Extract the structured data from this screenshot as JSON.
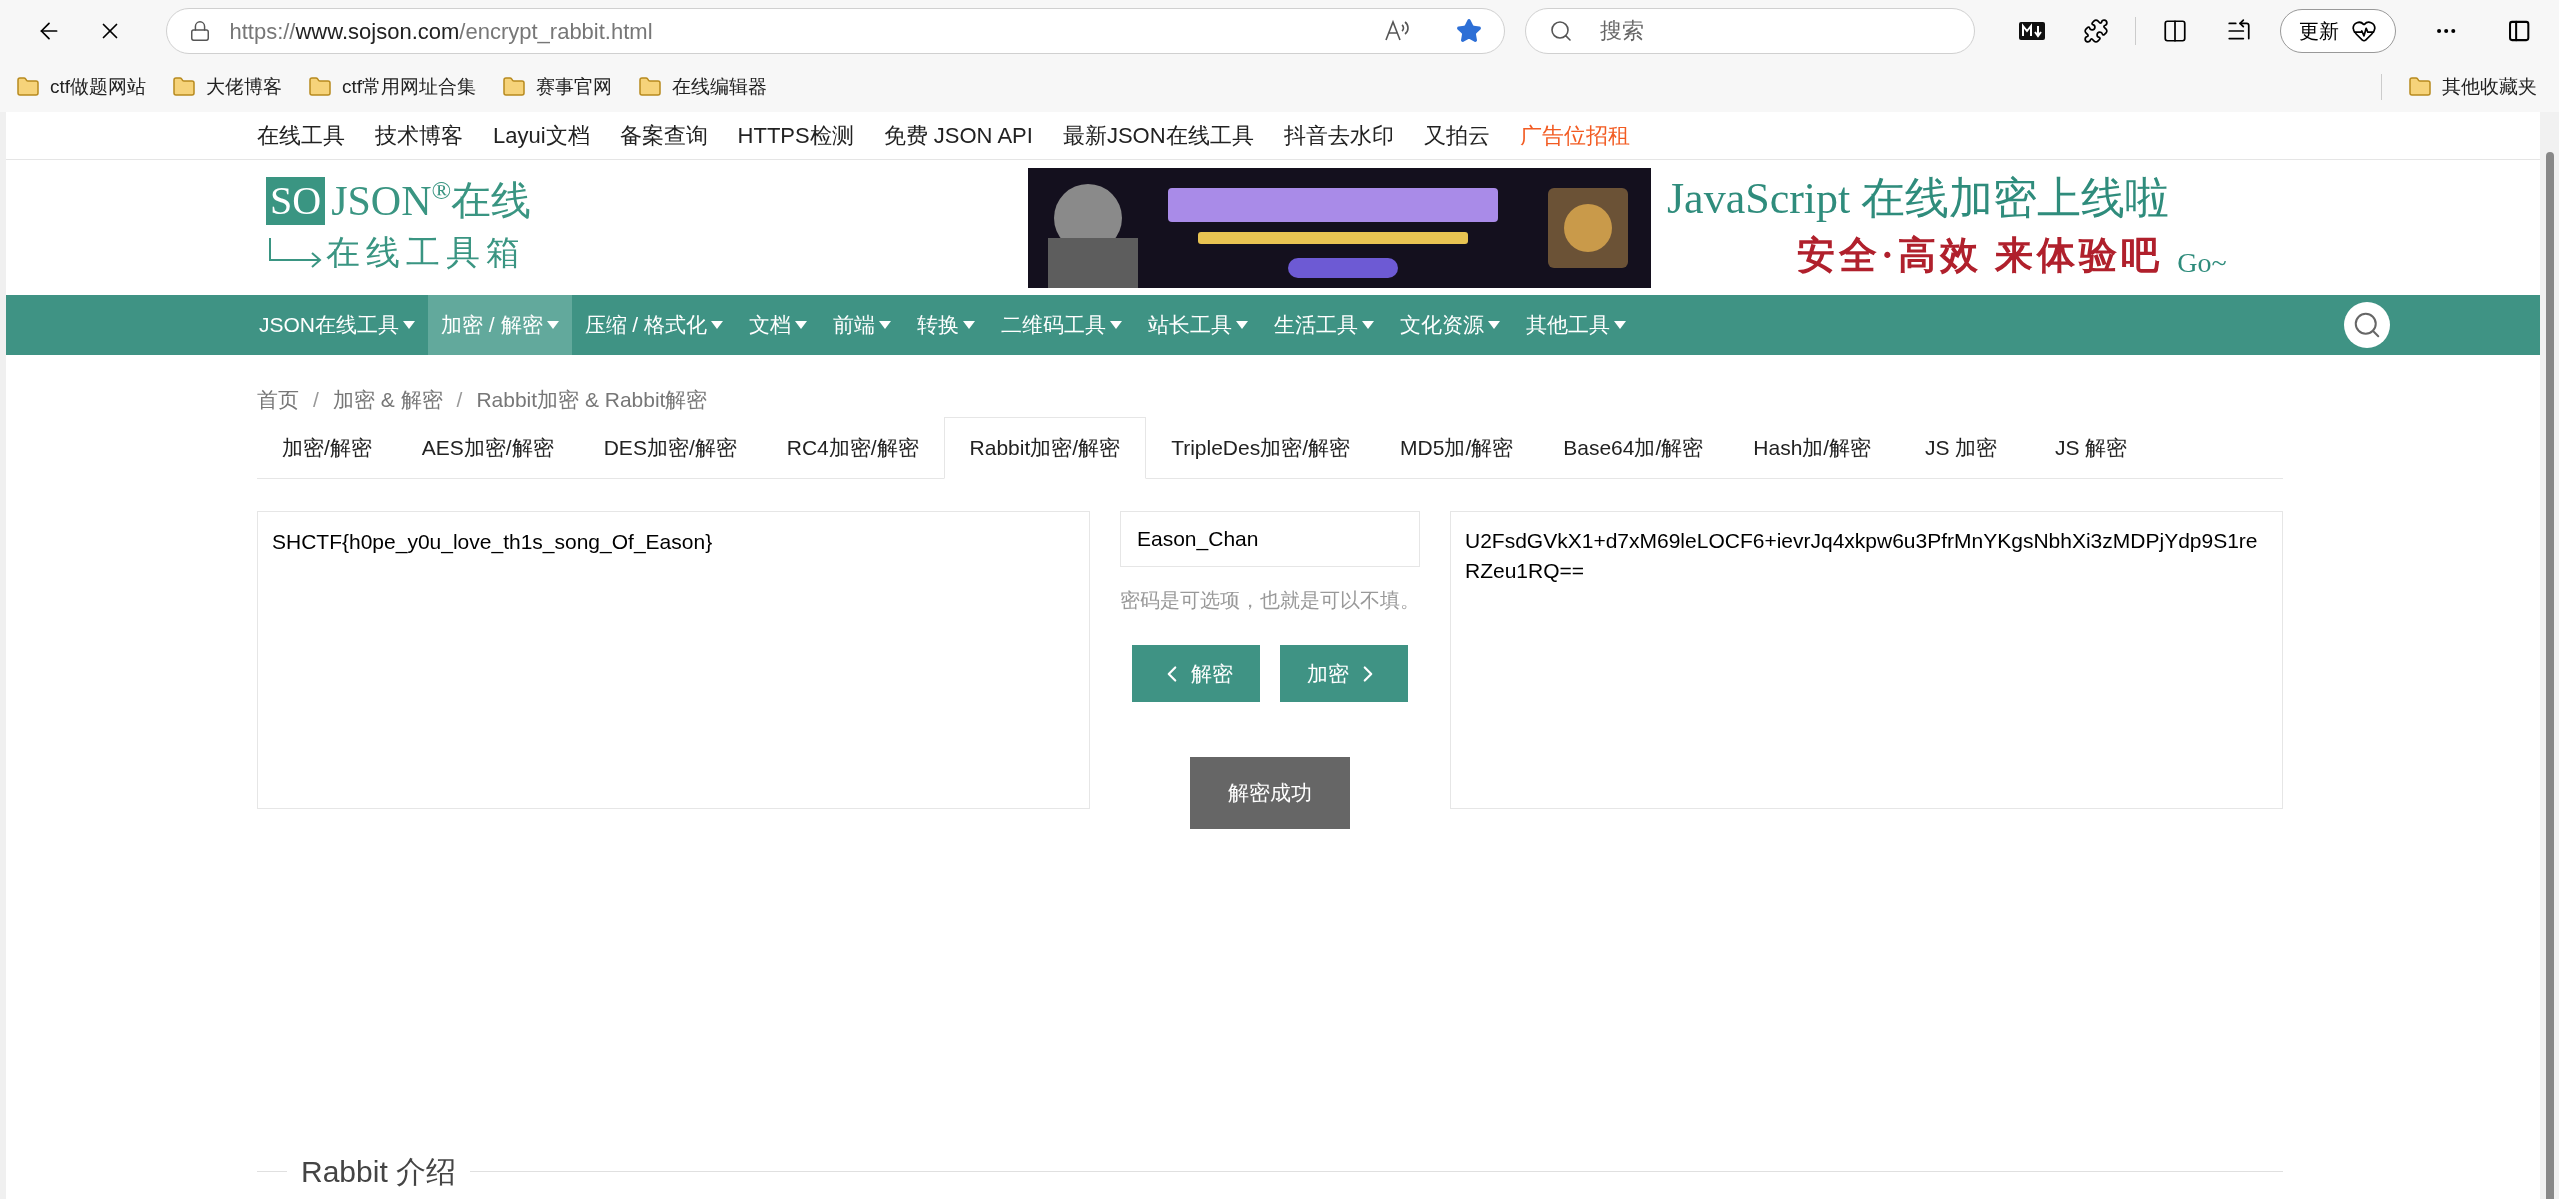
{
  "browser": {
    "loading": true,
    "url": {
      "scheme": "https://",
      "host": "www.sojson.com",
      "path": "/encrypt_rabbit.html"
    },
    "favorited": true,
    "search_placeholder": "搜索",
    "update_button": "更新",
    "bookmarks": [
      "ctf做题网站",
      "大佬博客",
      "ctf常用网址合集",
      "赛事官网",
      "在线编辑器"
    ],
    "other_bookmarks": "其他收藏夹"
  },
  "top_links": [
    {
      "label": "在线工具",
      "highlighted": false
    },
    {
      "label": "技术博客",
      "highlighted": false
    },
    {
      "label": "Layui文档",
      "highlighted": false
    },
    {
      "label": "备案查询",
      "highlighted": false
    },
    {
      "label": "HTTPS检测",
      "highlighted": false
    },
    {
      "label": "免费 JSON API",
      "highlighted": false
    },
    {
      "label": "最新JSON在线工具",
      "highlighted": false
    },
    {
      "label": "抖音去水印",
      "highlighted": false
    },
    {
      "label": "又拍云",
      "highlighted": false
    },
    {
      "label": "广告位招租",
      "highlighted": true
    }
  ],
  "logo": {
    "mark": "SO",
    "name": "JSON",
    "reg": "®",
    "suffix": "在线",
    "tagline": "在线工具箱"
  },
  "slogan": {
    "line1": "JavaScript 在线加密上线啦",
    "line2": "安全·高效 来体验吧",
    "go": "Go~"
  },
  "nav": [
    {
      "label": "JSON在线工具",
      "selected": false
    },
    {
      "label": "加密 / 解密",
      "selected": true
    },
    {
      "label": "压缩 / 格式化",
      "selected": false
    },
    {
      "label": "文档",
      "selected": false
    },
    {
      "label": "前端",
      "selected": false
    },
    {
      "label": "转换",
      "selected": false
    },
    {
      "label": "二维码工具",
      "selected": false
    },
    {
      "label": "站长工具",
      "selected": false
    },
    {
      "label": "生活工具",
      "selected": false
    },
    {
      "label": "文化资源",
      "selected": false
    },
    {
      "label": "其他工具",
      "selected": false
    }
  ],
  "breadcrumb": {
    "items": [
      "首页",
      "加密 & 解密",
      "Rabbit加密 & Rabbit解密"
    ],
    "separator": "/"
  },
  "tabs": [
    {
      "label": "加密/解密",
      "selected": false
    },
    {
      "label": "AES加密/解密",
      "selected": false
    },
    {
      "label": "DES加密/解密",
      "selected": false
    },
    {
      "label": "RC4加密/解密",
      "selected": false
    },
    {
      "label": "Rabbit加密/解密",
      "selected": true
    },
    {
      "label": "TripleDes加密/解密",
      "selected": false
    },
    {
      "label": "MD5加/解密",
      "selected": false
    },
    {
      "label": "Base64加/解密",
      "selected": false
    },
    {
      "label": "Hash加/解密",
      "selected": false
    },
    {
      "label": "JS 加密",
      "selected": false
    },
    {
      "label": "JS 解密",
      "selected": false
    }
  ],
  "form": {
    "plaintext": "SHCTF{h0pe_y0u_love_th1s_song_Of_Eason}",
    "password": "Eason_Chan",
    "hint": "密码是可选项，也就是可以不填。",
    "decrypt_button": "解密",
    "encrypt_button": "加密",
    "ciphertext": "U2FsdGVkX1+d7xM69leLOCF6+ievrJq4xkpw6u3PfrMnYKgsNbhXi3zMDPjYdp9S1reRZeu1RQ==",
    "status_button": "解密成功"
  },
  "section_title": "Rabbit 介绍"
}
